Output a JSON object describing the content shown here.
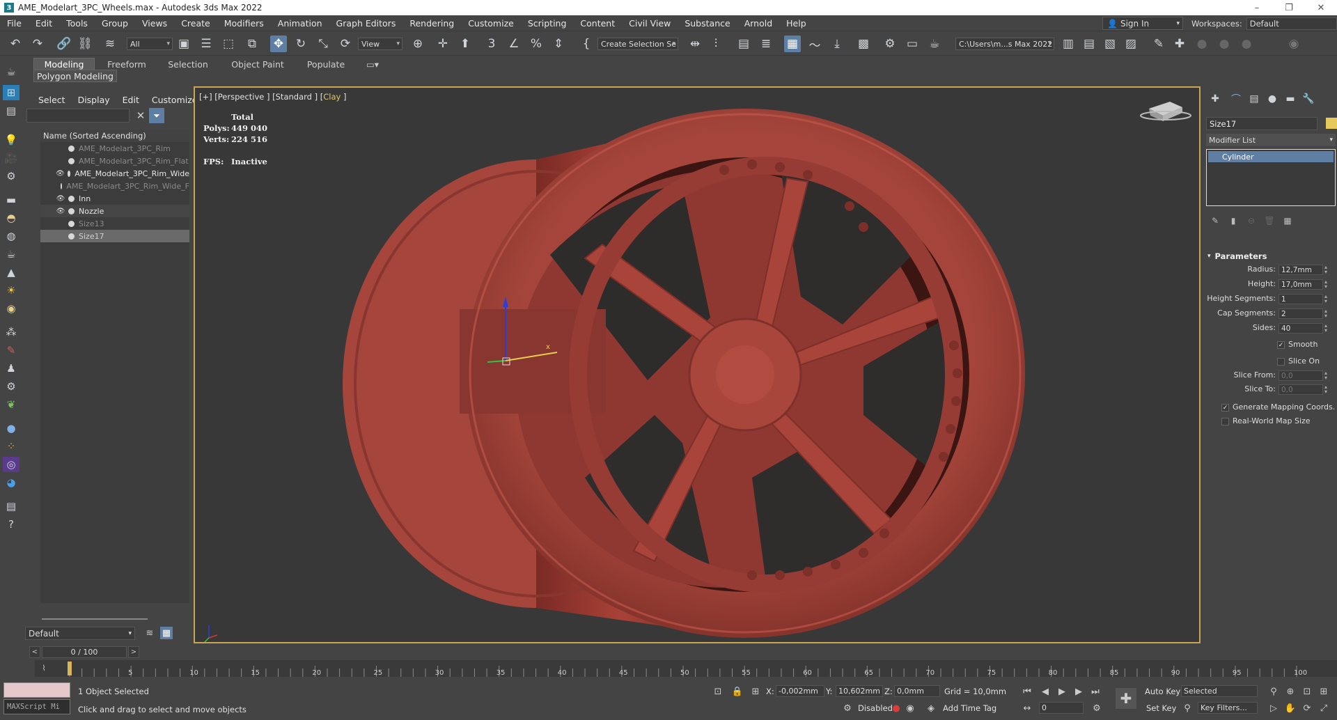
{
  "window": {
    "title": "AME_Modelart_3PC_Wheels.max - Autodesk 3ds Max 2022",
    "controls": [
      "–",
      "❐",
      "✕"
    ]
  },
  "menu": [
    "File",
    "Edit",
    "Tools",
    "Group",
    "Views",
    "Create",
    "Modifiers",
    "Animation",
    "Graph Editors",
    "Rendering",
    "Customize",
    "Scripting",
    "Content",
    "Civil View",
    "Substance",
    "Arnold",
    "Help"
  ],
  "account": {
    "sign_in": "Sign In",
    "workspaces_label": "Workspaces:",
    "workspace": "Default"
  },
  "toolbar": {
    "selection_filter": "All",
    "ref_coord": "View",
    "selection_set": "Create Selection Se",
    "project_path": "C:\\Users\\m...s Max 2022"
  },
  "ribbon": {
    "tabs": [
      "Modeling",
      "Freeform",
      "Selection",
      "Object Paint",
      "Populate"
    ],
    "active_tab": "Modeling",
    "panel": "Polygon Modeling"
  },
  "explorer": {
    "menu": [
      "Select",
      "Display",
      "Edit",
      "Customize"
    ],
    "search_value": "",
    "column_header": "Name (Sorted Ascending)",
    "objects": [
      {
        "name": "AME_Modelart_3PC_Rim",
        "visible": false
      },
      {
        "name": "AME_Modelart_3PC_Rim_Flat",
        "visible": false
      },
      {
        "name": "AME_Modelart_3PC_Rim_Wide",
        "visible": true
      },
      {
        "name": "AME_Modelart_3PC_Rim_Wide_F",
        "visible": false
      },
      {
        "name": "Inn",
        "visible": true
      },
      {
        "name": "Nozzle",
        "visible": true
      },
      {
        "name": "Size13",
        "visible": false
      },
      {
        "name": "Size17",
        "visible": false,
        "selected": true
      }
    ],
    "layer": "Default"
  },
  "viewport": {
    "label_prefix": "[+] [Perspective ] [Standard ] [",
    "label_shading": "Clay",
    "label_suffix": " ]",
    "stats": {
      "header": "Total",
      "polys_label": "Polys:",
      "polys": "449 040",
      "verts_label": "Verts:",
      "verts": "224 516",
      "fps_label": "FPS:",
      "fps": "Inactive"
    },
    "rim_color": "#a8433a"
  },
  "command_panel": {
    "object_name": "Size17",
    "object_color": "#e7c95b",
    "modifier_list": "Modifier List",
    "stack": [
      "Cylinder"
    ],
    "rollout": "Parameters",
    "params": {
      "radius_label": "Radius:",
      "radius": "12,7mm",
      "height_label": "Height:",
      "height": "17,0mm",
      "hseg_label": "Height Segments:",
      "hseg": "1",
      "capseg_label": "Cap Segments:",
      "capseg": "2",
      "sides_label": "Sides:",
      "sides": "40",
      "smooth_label": "Smooth",
      "smooth": true,
      "slice_on_label": "Slice On",
      "slice_on": false,
      "slice_from_label": "Slice From:",
      "slice_from": "0,0",
      "slice_to_label": "Slice To:",
      "slice_to": "0,0",
      "gen_map_label": "Generate Mapping Coords.",
      "gen_map": true,
      "real_world_label": "Real-World Map Size",
      "real_world": false
    }
  },
  "timeline": {
    "frame": "0 / 100",
    "ticks": [
      "5",
      "10",
      "15",
      "20",
      "25",
      "30",
      "35",
      "40",
      "45",
      "50",
      "55",
      "60",
      "65",
      "70",
      "75",
      "80",
      "85",
      "90",
      "95",
      "100"
    ]
  },
  "status": {
    "maxscript": "MAXScript Mi",
    "selection": "1 Object Selected",
    "prompt": "Click and drag to select and move objects",
    "x_label": "X:",
    "x": "-0,002mm",
    "y_label": "Y:",
    "y": "10,602mm",
    "z_label": "Z:",
    "z": "0,0mm",
    "grid": "Grid = 10,0mm",
    "disabled_label": "Disabled:",
    "add_time_tag": "Add Time Tag",
    "auto_key": "Auto Key",
    "set_key": "Set Key",
    "key_mode": "Selected",
    "key_filters": "Key Filters...",
    "current_frame": "0"
  }
}
